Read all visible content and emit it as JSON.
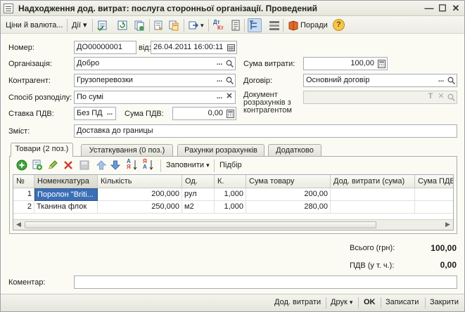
{
  "window": {
    "title": "Надходження дод. витрат: послуга сторонньої організації. Проведений",
    "minimize": "—",
    "restore": "☐",
    "close": "✕"
  },
  "toolbar": {
    "prices_label": "Ціни й валюта...",
    "actions_label": "Дії",
    "advice_label": "Поради",
    "help_glyph": "?",
    "dropdown_glyph": "▾",
    "dt_kt_label_top": "Дт",
    "dt_kt_label_bottom": "Кт"
  },
  "form": {
    "number_label": "Номер:",
    "number_value": "ДО00000001",
    "date_label": "від:",
    "date_value": "26.04.2011 16:00:11",
    "org_label": "Організація:",
    "org_value": "Добро",
    "sum_label": "Сума витрати:",
    "sum_value": "100,00",
    "contractor_label": "Контрагент:",
    "contractor_value": "Грузоперевозки",
    "contract_label": "Договір:",
    "contract_value": "Основний договір",
    "distribution_label": "Спосіб розподілу:",
    "distribution_value": "По сумі",
    "settlement_doc_label_1": "Документ",
    "settlement_doc_label_2": "розрахунків з",
    "settlement_doc_label_3": "контрагентом",
    "settlement_doc_value": "",
    "vat_rate_label": "Ставка ПДВ:",
    "vat_rate_value": "Без ПД",
    "vat_sum_label": "Сума ПДВ:",
    "vat_sum_value": "0,00",
    "content_label": "Зміст:",
    "content_value": "Доставка до границы",
    "ellipsis": "...",
    "clear_glyph": "✕",
    "search_glyph": "🔍",
    "t_glyph": "T"
  },
  "tabs": [
    {
      "label": "Товари (2 поз.)",
      "active": true
    },
    {
      "label": "Устаткування (0 поз.)",
      "active": false
    },
    {
      "label": "Рахунки розрахунків",
      "active": false
    },
    {
      "label": "Додатково",
      "active": false
    }
  ],
  "table_toolbar": {
    "fill_label": "Заповнити",
    "select_label": "Підбір",
    "dropdown_glyph": "▾",
    "sort_asc_top": "А",
    "sort_asc_bottom": "Я",
    "sort_desc_top": "Я",
    "sort_desc_bottom": "А"
  },
  "table": {
    "columns": [
      "№",
      "Номенклатура",
      "Кількість",
      "Од.",
      "К.",
      "Сума товару",
      "Дод. витрати (сума)",
      "Сума ПДВ"
    ],
    "rows": [
      {
        "n": "1",
        "item": "Поролон \"Briti...",
        "qty": "200,000",
        "unit": "рул",
        "k": "1,000",
        "sum": "200,00",
        "extra": "",
        "vat": ""
      },
      {
        "n": "2",
        "item": "Тканина флок",
        "qty": "250,000",
        "unit": "м2",
        "k": "1,000",
        "sum": "280,00",
        "extra": "",
        "vat": ""
      }
    ],
    "scroll_left": "◀",
    "scroll_right": "▶"
  },
  "totals": {
    "total_label": "Всього (грн):",
    "total_value": "100,00",
    "vat_label": "ПДВ (у т. ч.):",
    "vat_value": "0,00"
  },
  "comment": {
    "label": "Коментар:",
    "value": ""
  },
  "bottom": {
    "extra_costs_label": "Дод. витрати",
    "print_label": "Друк",
    "dropdown_glyph": "▾",
    "ok_label": "OK",
    "save_label": "Записати",
    "close_label": "Закрити"
  },
  "colors": {
    "selection": "#3b6fb6",
    "window_bg": "#fbfbf4",
    "accent_green": "#3fa33a",
    "accent_red": "#d13b2f"
  }
}
